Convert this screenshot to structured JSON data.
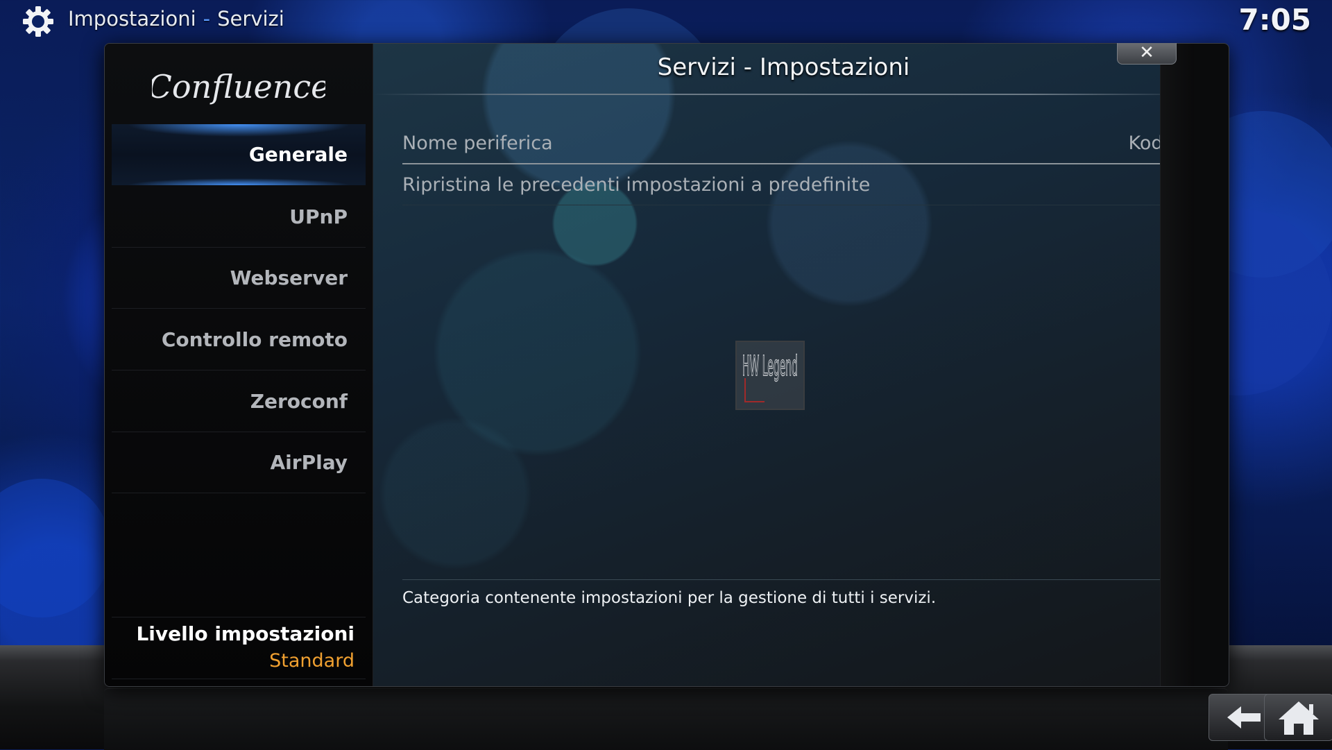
{
  "topbar": {
    "section": "Impostazioni",
    "separator": "-",
    "page": "Servizi",
    "clock": "7:05",
    "icon": "gear-icon"
  },
  "sidebar": {
    "logo_text": "Confluence",
    "items": [
      {
        "label": "Generale",
        "active": true
      },
      {
        "label": "UPnP",
        "active": false
      },
      {
        "label": "Webserver",
        "active": false
      },
      {
        "label": "Controllo remoto",
        "active": false
      },
      {
        "label": "Zeroconf",
        "active": false
      },
      {
        "label": "AirPlay",
        "active": false
      }
    ],
    "level_label": "Livello impostazioni",
    "level_value": "Standard"
  },
  "dialog": {
    "title": "Servizi - Impostazioni",
    "close_icon": "close-icon",
    "settings": [
      {
        "label": "Nome periferica",
        "value": "Kodi"
      },
      {
        "label": "Ripristina le precedenti impostazioni a predefinite"
      }
    ],
    "description": "Categoria contenente impostazioni per la gestione di tutti i servizi."
  },
  "watermark": {
    "text": "HW Legend"
  },
  "footer": {
    "back_icon": "back-arrow-icon",
    "home_icon": "home-icon"
  },
  "colors": {
    "accent_blue": "#4696ff",
    "level_value": "#f0a030",
    "text": "#b3b6bb"
  }
}
